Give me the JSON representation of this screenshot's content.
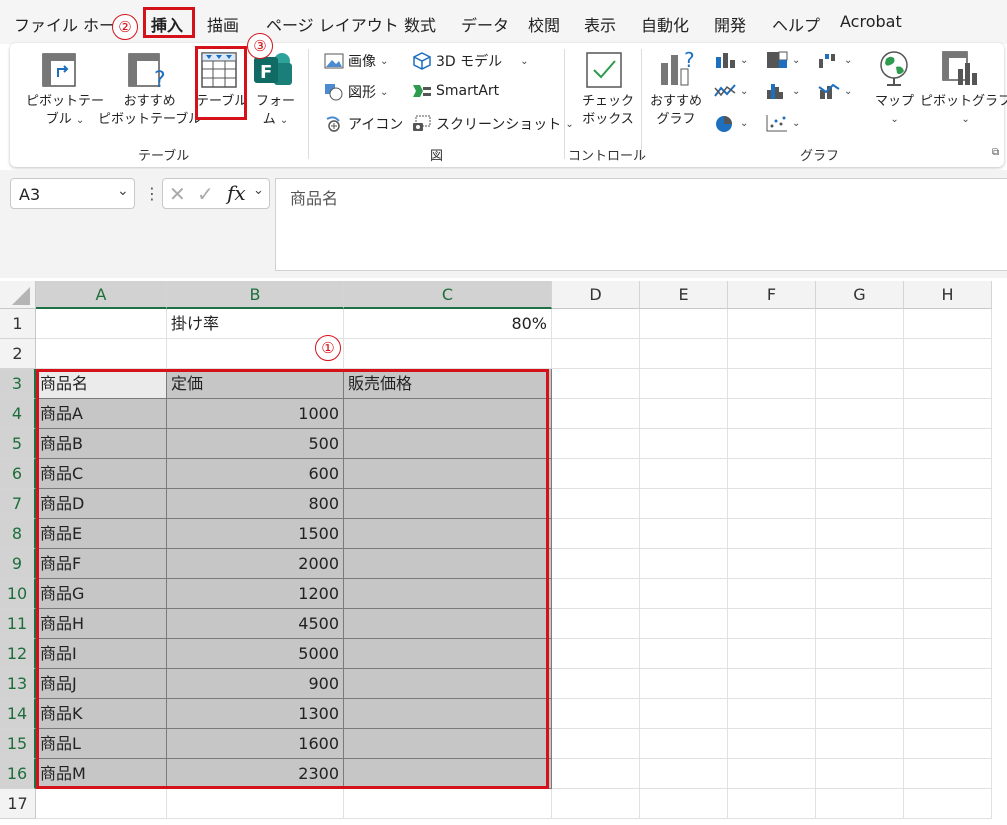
{
  "menu": {
    "items": [
      "ファイル",
      "ホーム",
      "挿入",
      "描画",
      "ページ レイアウト",
      "数式",
      "データ",
      "校閲",
      "表示",
      "自動化",
      "開発",
      "ヘルプ",
      "Acrobat"
    ]
  },
  "ribbon": {
    "pivot_table": {
      "line1": "ピボットテー",
      "line2": "ブル"
    },
    "recommended_pivot": {
      "line1": "おすすめ",
      "line2": "ピボットテーブル"
    },
    "table": "テーブル",
    "forms": {
      "line1": "フォー",
      "line2": "ム"
    },
    "group_table": "テーブル",
    "picture": "画像",
    "shapes": "図形",
    "icons": "アイコン",
    "model3d": "3D モデル",
    "smartart": "SmartArt",
    "screenshot": "スクリーンショット",
    "group_illustrations": "図",
    "checkbox": {
      "line1": "チェック",
      "line2": "ボックス"
    },
    "group_controls": "コントロール",
    "recommended_charts": {
      "line1": "おすすめ",
      "line2": "グラフ"
    },
    "maps": "マップ",
    "pivot_chart": "ピボットグラフ",
    "group_charts": "グラフ"
  },
  "formula_bar": {
    "name_box": "A3",
    "fx": "fx",
    "content": "商品名"
  },
  "sheet": {
    "columns": [
      "A",
      "B",
      "C",
      "D",
      "E",
      "F",
      "G",
      "H"
    ],
    "rows": [
      "1",
      "2",
      "3",
      "4",
      "5",
      "6",
      "7",
      "8",
      "9",
      "10",
      "11",
      "12",
      "13",
      "14",
      "15",
      "16",
      "17"
    ],
    "b1": "掛け率",
    "c1": "80%",
    "headers": [
      "商品名",
      "定価",
      "販売価格"
    ],
    "products": [
      {
        "name": "商品A",
        "price": "1000"
      },
      {
        "name": "商品B",
        "price": "500"
      },
      {
        "name": "商品C",
        "price": "600"
      },
      {
        "name": "商品D",
        "price": "800"
      },
      {
        "name": "商品E",
        "price": "1500"
      },
      {
        "name": "商品F",
        "price": "2000"
      },
      {
        "name": "商品G",
        "price": "1200"
      },
      {
        "name": "商品H",
        "price": "4500"
      },
      {
        "name": "商品I",
        "price": "5000"
      },
      {
        "name": "商品J",
        "price": "900"
      },
      {
        "name": "商品K",
        "price": "1300"
      },
      {
        "name": "商品L",
        "price": "1600"
      },
      {
        "name": "商品M",
        "price": "2300"
      }
    ]
  },
  "annotations": {
    "step1": "①",
    "step2": "②",
    "step3": "③"
  },
  "colors": {
    "accent_red": "#d5121a",
    "excel_green": "#1e7145",
    "table_fill": "#c6c6c6"
  }
}
